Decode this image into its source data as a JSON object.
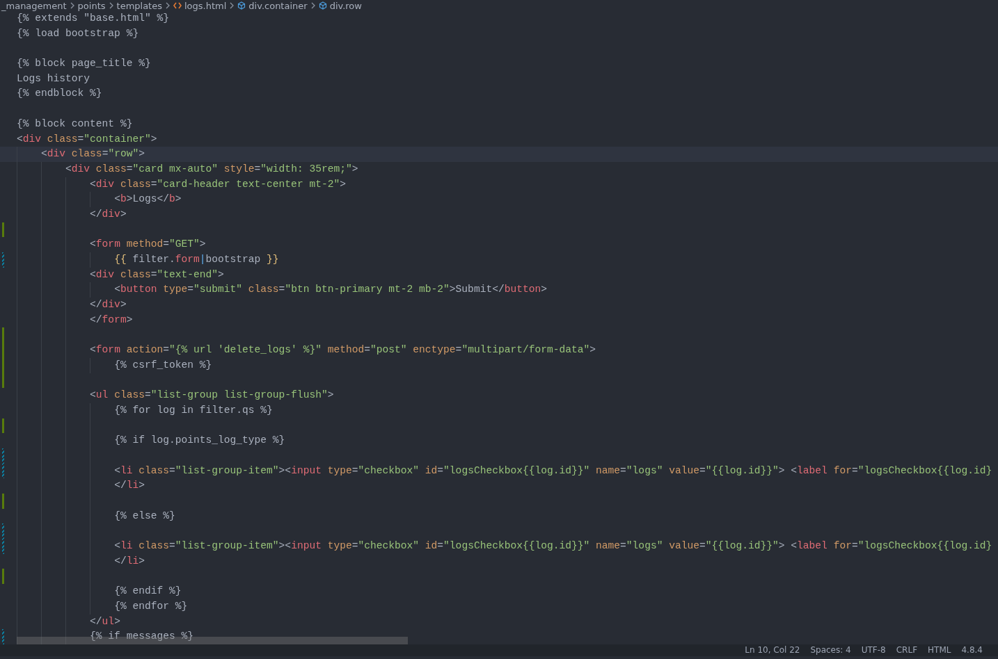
{
  "breadcrumbs": [
    {
      "kind": "folder",
      "text": "_management"
    },
    {
      "kind": "folder",
      "text": "points"
    },
    {
      "kind": "folder",
      "text": "templates"
    },
    {
      "kind": "file",
      "text": "logs.html"
    },
    {
      "kind": "element",
      "text": "div.container"
    },
    {
      "kind": "element",
      "text": "div.row"
    }
  ],
  "lines": [
    {
      "kind": "plain",
      "current": false,
      "tokens": [
        {
          "kind": "txt",
          "text": "{% extends \"base.html\" %}"
        }
      ]
    },
    {
      "kind": "plain",
      "current": false,
      "tokens": [
        {
          "kind": "txt",
          "text": "{% load bootstrap %}"
        }
      ]
    },
    {
      "kind": "plain",
      "current": false
    },
    {
      "kind": "plain",
      "current": false,
      "tokens": [
        {
          "kind": "txt",
          "text": "{% block page_title %}"
        }
      ]
    },
    {
      "kind": "plain",
      "current": false,
      "tokens": [
        {
          "kind": "txt",
          "text": "Logs history"
        }
      ]
    },
    {
      "kind": "plain",
      "current": false,
      "tokens": [
        {
          "kind": "txt",
          "text": "{% endblock %}"
        }
      ]
    },
    {
      "kind": "plain",
      "current": false
    },
    {
      "kind": "plain",
      "current": false,
      "tokens": [
        {
          "kind": "txt",
          "text": "{% block content %}"
        }
      ]
    },
    {
      "kind": "plain",
      "current": false,
      "tokens": [
        {
          "kind": "p",
          "text": "<"
        },
        {
          "kind": "tag",
          "text": "div"
        },
        {
          "kind": "attr",
          "text": " class"
        },
        {
          "kind": "p",
          "text": "="
        },
        {
          "kind": "str",
          "text": "\"container\""
        },
        {
          "kind": "p",
          "text": ">"
        }
      ]
    },
    {
      "kind": "plain",
      "current": true,
      "tokens": [
        {
          "kind": "p",
          "text": "    <"
        },
        {
          "kind": "tag",
          "text": "div"
        },
        {
          "kind": "attr",
          "text": " class"
        },
        {
          "kind": "p",
          "text": "="
        },
        {
          "kind": "str",
          "text": "\"row\""
        },
        {
          "kind": "p",
          "text": ">"
        }
      ]
    },
    {
      "kind": "plain",
      "current": false,
      "tokens": [
        {
          "kind": "p",
          "text": "        <"
        },
        {
          "kind": "tag",
          "text": "div"
        },
        {
          "kind": "attr",
          "text": " class"
        },
        {
          "kind": "p",
          "text": "="
        },
        {
          "kind": "str",
          "text": "\"card mx-auto\""
        },
        {
          "kind": "attr",
          "text": " style"
        },
        {
          "kind": "p",
          "text": "="
        },
        {
          "kind": "str",
          "text": "\"width: 35rem;\""
        },
        {
          "kind": "p",
          "text": ">"
        }
      ]
    },
    {
      "kind": "plain",
      "current": false,
      "tokens": [
        {
          "kind": "p",
          "text": "            <"
        },
        {
          "kind": "tag",
          "text": "div"
        },
        {
          "kind": "attr",
          "text": " class"
        },
        {
          "kind": "p",
          "text": "="
        },
        {
          "kind": "str",
          "text": "\"card-header text-center mt-2\""
        },
        {
          "kind": "p",
          "text": ">"
        }
      ]
    },
    {
      "kind": "plain",
      "current": false,
      "tokens": [
        {
          "kind": "p",
          "text": "                <"
        },
        {
          "kind": "tag",
          "text": "b"
        },
        {
          "kind": "p",
          "text": ">"
        },
        {
          "kind": "txt",
          "text": "Logs"
        },
        {
          "kind": "p",
          "text": "</"
        },
        {
          "kind": "tag",
          "text": "b"
        },
        {
          "kind": "p",
          "text": ">"
        }
      ]
    },
    {
      "kind": "plain",
      "current": false,
      "tokens": [
        {
          "kind": "p",
          "text": "            </"
        },
        {
          "kind": "tag",
          "text": "div"
        },
        {
          "kind": "p",
          "text": ">"
        }
      ]
    },
    {
      "kind": "added",
      "current": false
    },
    {
      "kind": "plain",
      "current": false,
      "tokens": [
        {
          "kind": "p",
          "text": "            <"
        },
        {
          "kind": "tag",
          "text": "form"
        },
        {
          "kind": "attr",
          "text": " method"
        },
        {
          "kind": "p",
          "text": "="
        },
        {
          "kind": "str",
          "text": "\"GET\""
        },
        {
          "kind": "p",
          "text": ">"
        }
      ]
    },
    {
      "kind": "modified",
      "current": false,
      "tokens": [
        {
          "kind": "brace",
          "text": "                {{"
        },
        {
          "kind": "txt",
          "text": " filter."
        },
        {
          "kind": "tag",
          "text": "form"
        },
        {
          "kind": "pipe",
          "text": "|"
        },
        {
          "kind": "txt",
          "text": "bootstrap "
        },
        {
          "kind": "brace",
          "text": "}}"
        }
      ]
    },
    {
      "kind": "plain",
      "current": false,
      "tokens": [
        {
          "kind": "p",
          "text": "            <"
        },
        {
          "kind": "tag",
          "text": "div"
        },
        {
          "kind": "attr",
          "text": " class"
        },
        {
          "kind": "p",
          "text": "="
        },
        {
          "kind": "str",
          "text": "\"text-end\""
        },
        {
          "kind": "p",
          "text": ">"
        }
      ]
    },
    {
      "kind": "plain",
      "current": false,
      "tokens": [
        {
          "kind": "p",
          "text": "                <"
        },
        {
          "kind": "tag",
          "text": "button"
        },
        {
          "kind": "attr",
          "text": " type"
        },
        {
          "kind": "p",
          "text": "="
        },
        {
          "kind": "str",
          "text": "\"submit\""
        },
        {
          "kind": "attr",
          "text": " class"
        },
        {
          "kind": "p",
          "text": "="
        },
        {
          "kind": "str",
          "text": "\"btn btn-primary mt-2 mb-2\""
        },
        {
          "kind": "p",
          "text": ">"
        },
        {
          "kind": "txt",
          "text": "Submit"
        },
        {
          "kind": "p",
          "text": "</"
        },
        {
          "kind": "tag",
          "text": "button"
        },
        {
          "kind": "p",
          "text": ">"
        }
      ]
    },
    {
      "kind": "plain",
      "current": false,
      "tokens": [
        {
          "kind": "p",
          "text": "            </"
        },
        {
          "kind": "tag",
          "text": "div"
        },
        {
          "kind": "p",
          "text": ">"
        }
      ]
    },
    {
      "kind": "plain",
      "current": false,
      "tokens": [
        {
          "kind": "p",
          "text": "            </"
        },
        {
          "kind": "tag",
          "text": "form"
        },
        {
          "kind": "p",
          "text": ">"
        }
      ]
    },
    {
      "kind": "added",
      "current": false
    },
    {
      "kind": "added",
      "current": false,
      "tokens": [
        {
          "kind": "p",
          "text": "            <"
        },
        {
          "kind": "tag",
          "text": "form"
        },
        {
          "kind": "attr",
          "text": " action"
        },
        {
          "kind": "p",
          "text": "="
        },
        {
          "kind": "str",
          "text": "\"{% url 'delete_logs' %}\""
        },
        {
          "kind": "attr",
          "text": " method"
        },
        {
          "kind": "p",
          "text": "="
        },
        {
          "kind": "str",
          "text": "\"post\""
        },
        {
          "kind": "attr",
          "text": " enctype"
        },
        {
          "kind": "p",
          "text": "="
        },
        {
          "kind": "str",
          "text": "\"multipart/form-data\""
        },
        {
          "kind": "p",
          "text": ">"
        }
      ]
    },
    {
      "kind": "added",
      "current": false,
      "tokens": [
        {
          "kind": "txt",
          "text": "                {% csrf_token %}"
        }
      ]
    },
    {
      "kind": "added",
      "current": false
    },
    {
      "kind": "plain",
      "current": false,
      "tokens": [
        {
          "kind": "p",
          "text": "            <"
        },
        {
          "kind": "tag",
          "text": "ul"
        },
        {
          "kind": "attr",
          "text": " class"
        },
        {
          "kind": "p",
          "text": "="
        },
        {
          "kind": "str",
          "text": "\"list-group list-group-flush\""
        },
        {
          "kind": "p",
          "text": ">"
        }
      ]
    },
    {
      "kind": "plain",
      "current": false,
      "tokens": [
        {
          "kind": "txt",
          "text": "                {% for log in filter.qs %}"
        }
      ]
    },
    {
      "kind": "added",
      "current": false
    },
    {
      "kind": "plain",
      "current": false,
      "tokens": [
        {
          "kind": "txt",
          "text": "                {% if log.points_log_type %}"
        }
      ]
    },
    {
      "kind": "modified",
      "current": false
    },
    {
      "kind": "modified",
      "current": false,
      "tokens": [
        {
          "kind": "p",
          "text": "                <"
        },
        {
          "kind": "tag",
          "text": "li"
        },
        {
          "kind": "attr",
          "text": " class"
        },
        {
          "kind": "p",
          "text": "="
        },
        {
          "kind": "str",
          "text": "\"list-group-item\""
        },
        {
          "kind": "p",
          "text": "><"
        },
        {
          "kind": "tag",
          "text": "input"
        },
        {
          "kind": "attr",
          "text": " type"
        },
        {
          "kind": "p",
          "text": "="
        },
        {
          "kind": "str",
          "text": "\"checkbox\""
        },
        {
          "kind": "attr",
          "text": " id"
        },
        {
          "kind": "p",
          "text": "="
        },
        {
          "kind": "str",
          "text": "\"logsCheckbox{{log.id}}\""
        },
        {
          "kind": "attr",
          "text": " name"
        },
        {
          "kind": "p",
          "text": "="
        },
        {
          "kind": "str",
          "text": "\"logs\""
        },
        {
          "kind": "attr",
          "text": " value"
        },
        {
          "kind": "p",
          "text": "="
        },
        {
          "kind": "str",
          "text": "\"{{log.id}}\""
        },
        {
          "kind": "p",
          "text": "> <"
        },
        {
          "kind": "tag",
          "text": "label"
        },
        {
          "kind": "attr",
          "text": " for"
        },
        {
          "kind": "p",
          "text": "="
        },
        {
          "kind": "str",
          "text": "\"logsCheckbox{{log.id}"
        }
      ]
    },
    {
      "kind": "plain",
      "current": false,
      "tokens": [
        {
          "kind": "p",
          "text": "                </"
        },
        {
          "kind": "tag",
          "text": "li"
        },
        {
          "kind": "p",
          "text": ">"
        }
      ]
    },
    {
      "kind": "added",
      "current": false
    },
    {
      "kind": "plain",
      "current": false,
      "tokens": [
        {
          "kind": "txt",
          "text": "                {% else %}"
        }
      ]
    },
    {
      "kind": "modified",
      "current": false
    },
    {
      "kind": "modified",
      "current": false,
      "tokens": [
        {
          "kind": "p",
          "text": "                <"
        },
        {
          "kind": "tag",
          "text": "li"
        },
        {
          "kind": "attr",
          "text": " class"
        },
        {
          "kind": "p",
          "text": "="
        },
        {
          "kind": "str",
          "text": "\"list-group-item\""
        },
        {
          "kind": "p",
          "text": "><"
        },
        {
          "kind": "tag",
          "text": "input"
        },
        {
          "kind": "attr",
          "text": " type"
        },
        {
          "kind": "p",
          "text": "="
        },
        {
          "kind": "str",
          "text": "\"checkbox\""
        },
        {
          "kind": "attr",
          "text": " id"
        },
        {
          "kind": "p",
          "text": "="
        },
        {
          "kind": "str",
          "text": "\"logsCheckbox{{log.id}}\""
        },
        {
          "kind": "attr",
          "text": " name"
        },
        {
          "kind": "p",
          "text": "="
        },
        {
          "kind": "str",
          "text": "\"logs\""
        },
        {
          "kind": "attr",
          "text": " value"
        },
        {
          "kind": "p",
          "text": "="
        },
        {
          "kind": "str",
          "text": "\"{{log.id}}\""
        },
        {
          "kind": "p",
          "text": "> <"
        },
        {
          "kind": "tag",
          "text": "label"
        },
        {
          "kind": "attr",
          "text": " for"
        },
        {
          "kind": "p",
          "text": "="
        },
        {
          "kind": "str",
          "text": "\"logsCheckbox{{log.id}"
        }
      ]
    },
    {
      "kind": "plain",
      "current": false,
      "tokens": [
        {
          "kind": "p",
          "text": "                </"
        },
        {
          "kind": "tag",
          "text": "li"
        },
        {
          "kind": "p",
          "text": ">"
        }
      ]
    },
    {
      "kind": "added",
      "current": false
    },
    {
      "kind": "plain",
      "current": false,
      "tokens": [
        {
          "kind": "txt",
          "text": "                {% endif %}"
        }
      ]
    },
    {
      "kind": "plain",
      "current": false,
      "tokens": [
        {
          "kind": "txt",
          "text": "                {% endfor %}"
        }
      ]
    },
    {
      "kind": "plain",
      "current": false,
      "tokens": [
        {
          "kind": "p",
          "text": "            </"
        },
        {
          "kind": "tag",
          "text": "ul"
        },
        {
          "kind": "p",
          "text": ">"
        }
      ]
    },
    {
      "kind": "modified",
      "current": false,
      "tokens": [
        {
          "kind": "txt",
          "text": "            {% if messages %}"
        }
      ]
    }
  ],
  "status_bar": [
    {
      "text": "Ln 10, Col 22"
    },
    {
      "text": "Spaces: 4"
    },
    {
      "text": "UTF-8"
    },
    {
      "text": "CRLF"
    },
    {
      "text": "HTML"
    },
    {
      "text": "4.8.4"
    }
  ]
}
